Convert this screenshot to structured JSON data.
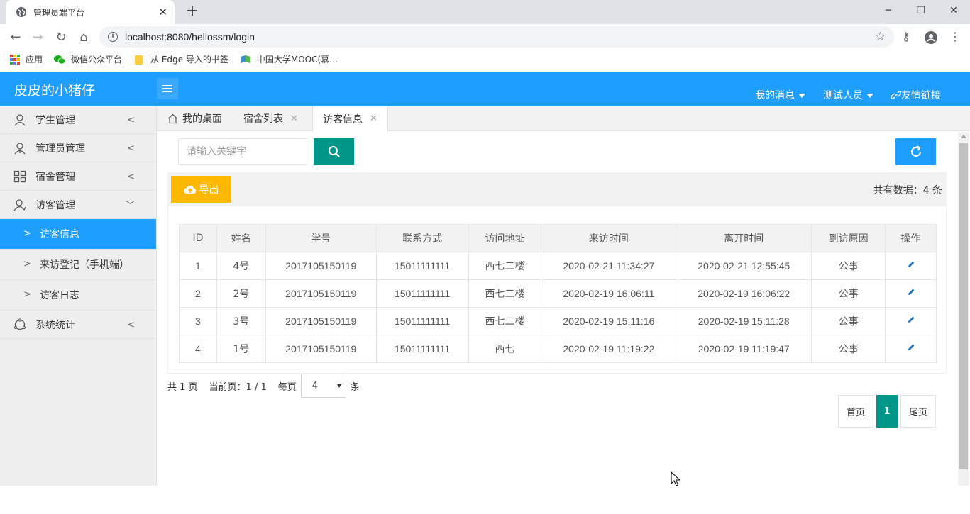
{
  "browser": {
    "tab_title": "管理员端平台",
    "url": "localhost:8080/hellossm/login",
    "bookmarks": [
      {
        "label": "应用",
        "icon": "apps-grid-icon"
      },
      {
        "label": "微信公众平台",
        "icon": "wechat-icon"
      },
      {
        "label": "从 Edge 导入的书签",
        "icon": "folder-icon"
      },
      {
        "label": "中国大学MOOC(慕…",
        "icon": "mooc-icon"
      }
    ]
  },
  "header": {
    "logo": "皮皮的小猪仔",
    "messages": "我的消息",
    "user": "测试人员",
    "links": "友情链接",
    "accent_color": "#1e9fff"
  },
  "sidebar": {
    "items": [
      {
        "label": "学生管理",
        "icon": "user-icon"
      },
      {
        "label": "管理员管理",
        "icon": "admin-icon"
      },
      {
        "label": "宿舍管理",
        "icon": "grid-icon"
      },
      {
        "label": "访客管理",
        "icon": "visitor-icon"
      }
    ],
    "sub_items": [
      {
        "label": "访客信息",
        "active": true
      },
      {
        "label": "来访登记（手机端）",
        "active": false
      },
      {
        "label": "访客日志",
        "active": false
      }
    ],
    "stats": {
      "label": "系统统计",
      "icon": "chart-icon"
    }
  },
  "page_tabs": [
    {
      "label": "我的桌面",
      "icon": "home-icon"
    },
    {
      "label": "宿舍列表"
    },
    {
      "label": "访客信息"
    }
  ],
  "search": {
    "placeholder": "请输入关键字"
  },
  "toolbar": {
    "export_label": "导出",
    "total_text": "共有数据：4 条"
  },
  "table": {
    "columns": [
      "ID",
      "姓名",
      "学号",
      "联系方式",
      "访问地址",
      "来访时间",
      "离开时间",
      "到访原因",
      "操作"
    ],
    "rows": [
      [
        "1",
        "4号",
        "2017105150119",
        "15011111111",
        "西七二楼",
        "2020-02-21 11:34:27",
        "2020-02-21 12:55:45",
        "公事"
      ],
      [
        "2",
        "2号",
        "2017105150119",
        "15011111111",
        "西七二楼",
        "2020-02-19 16:06:11",
        "2020-02-19 16:06:22",
        "公事"
      ],
      [
        "3",
        "3号",
        "2017105150119",
        "15011111111",
        "西七二楼",
        "2020-02-19 15:11:16",
        "2020-02-19 15:11:28",
        "公事"
      ],
      [
        "4",
        "1号",
        "2017105150119",
        "15011111111",
        "西七",
        "2020-02-19 11:19:22",
        "2020-02-19 11:19:47",
        "公事"
      ]
    ]
  },
  "pagination": {
    "total_pages": "共 1 页",
    "current": "当前页：1 / 1",
    "per_page_label": "每页",
    "per_page_value": "4",
    "per_page_unit": "条",
    "first": "首页",
    "page": "1",
    "last": "尾页"
  }
}
